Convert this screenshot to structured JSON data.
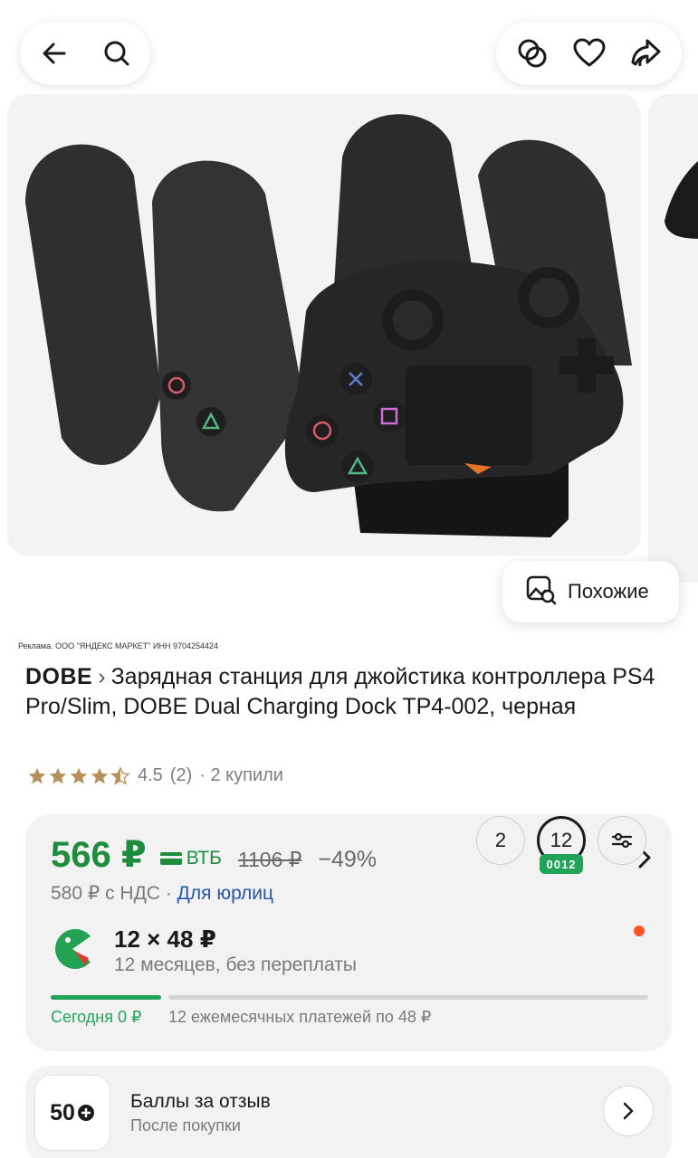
{
  "topbar": {
    "back_icon": "arrow-left-icon",
    "search_icon": "search-icon",
    "compare_icon": "compare-icon",
    "favorite_icon": "heart-icon",
    "share_icon": "share-icon"
  },
  "gallery": {
    "image": "dobe-charging-dock-ps4-controllers",
    "similar_label": "Похожие"
  },
  "ad_disclaimer": "Реклама. ООО \"ЯНДЕКС МАРКЕТ\" ИНН 9704254424",
  "product": {
    "brand": "DOBE",
    "title": "Зарядная станция для джойстика контроллера PS4 Pro/Slim, DOBE Dual Charging Dock TP4-002, черная",
    "rating": "4.5",
    "rating_value": 4.5,
    "reviews": "(2)",
    "purchases": "· 2 купили"
  },
  "price": {
    "current": "566 ₽",
    "bank": "ВТБ",
    "old": "1106 ₽",
    "discount": "−49%",
    "vat": "580 ₽ с НДС",
    "separator": "·",
    "legal_link": "Для юрлиц"
  },
  "installment": {
    "title": "12 × 48 ₽",
    "subtitle": "12 месяцев, без переплаты",
    "term_options": [
      "2",
      "12"
    ],
    "selected_term": "12",
    "badge": "0012",
    "today": "Сегодня 0 ₽",
    "monthly": "12 ежемесячных платежей по 48 ₽",
    "progress_fraction": 0.185
  },
  "bonus": {
    "points": "50",
    "title": "Баллы за отзыв",
    "subtitle": "После покупки"
  },
  "colors": {
    "green": "#1f8d3e",
    "accent_green": "#21a35a",
    "link_blue": "#2656a6",
    "notification": "#ff5226",
    "card_bg": "#f2f2f2"
  }
}
